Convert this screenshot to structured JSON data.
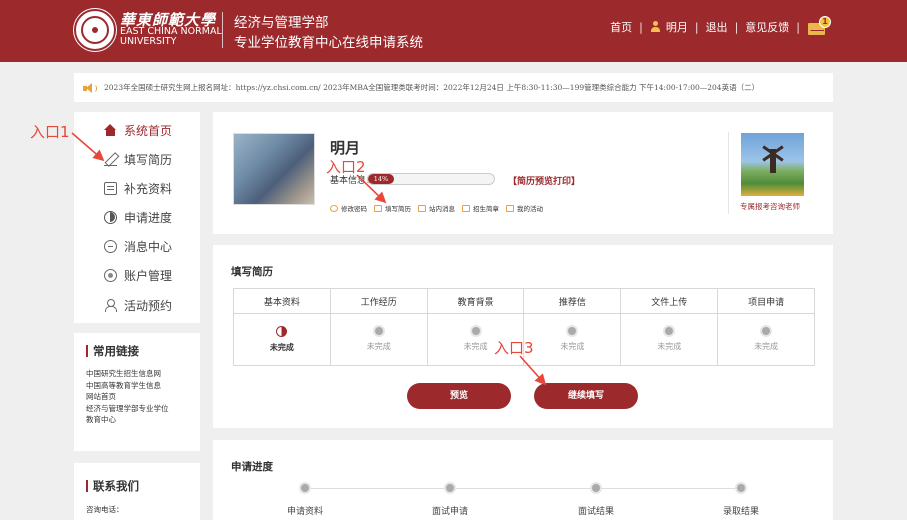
{
  "header": {
    "logo_cn": "華東師範大學",
    "logo_en_line1": "EAST CHINA NORMAL",
    "logo_en_line2": "UNIVERSITY",
    "system_line1": "经济与管理学部",
    "system_line2": "专业学位教育中心在线申请系统",
    "nav": {
      "home": "首页",
      "user": "明月",
      "logout": "退出",
      "feedback": "意见反馈",
      "mail_badge": "1"
    },
    "colors": {
      "brand": "#9c2a2c",
      "accent": "#e8a23c"
    }
  },
  "notice": {
    "text": "2023年全国硕士研究生网上报名网址：https://yz.chsi.com.cn/ 2023年MBA全国管理类联考时间：2022年12月24日 上午8:30-11:30—199管理类综合能力 下午14:00-17:00—204英语（二）"
  },
  "sidebar": {
    "items": [
      {
        "label": "系统首页",
        "icon": "home-icon",
        "active": true
      },
      {
        "label": "填写简历",
        "icon": "edit-icon",
        "active": false
      },
      {
        "label": "补充资料",
        "icon": "document-icon",
        "active": false
      },
      {
        "label": "申请进度",
        "icon": "progress-icon",
        "active": false
      },
      {
        "label": "消息中心",
        "icon": "message-icon",
        "active": false
      },
      {
        "label": "账户管理",
        "icon": "account-icon",
        "active": false
      },
      {
        "label": "活动预约",
        "icon": "activity-icon",
        "active": false
      }
    ]
  },
  "links": {
    "title": "常用链接",
    "items": [
      "中国研究生招生信息网",
      "中国高等教育学生信息",
      "网站首页",
      "经济与管理学部专业学位",
      "教育中心"
    ]
  },
  "contact": {
    "title": "联系我们",
    "phone_label": "咨询电话："
  },
  "profile": {
    "name": "明月",
    "info_label": "基本信息：",
    "progress_text": "14%",
    "progress_value": 0.14,
    "print_link": "【简历预览打印】",
    "quick_links": [
      "修改密码",
      "填写简历",
      "站内消息",
      "招生简章",
      "我的活动"
    ],
    "advisor_label": "专属报考咨询老师"
  },
  "resume": {
    "title": "填写简历",
    "columns": [
      "基本资料",
      "工作经历",
      "教育背景",
      "推荐信",
      "文件上传",
      "项目申请"
    ],
    "statuses": [
      "未完成",
      "未完成",
      "未完成",
      "未完成",
      "未完成",
      "未完成"
    ],
    "preview_button": "预览",
    "continue_button": "继续填写"
  },
  "progress": {
    "title": "申请进度",
    "steps": [
      "申请资料",
      "面试申请",
      "面试结果",
      "录取结果"
    ]
  },
  "annotations": {
    "entry1": "入口1",
    "entry2": "入口2",
    "entry3": "入口3",
    "color": "#e8473a"
  }
}
